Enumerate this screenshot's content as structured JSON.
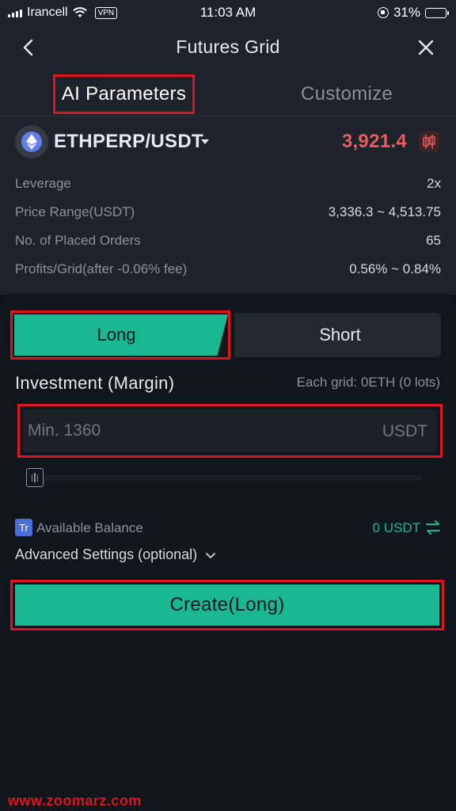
{
  "status_bar": {
    "carrier": "Irancell",
    "vpn": "VPN",
    "time": "11:03 AM",
    "battery": "31%",
    "battery_level": 0.31
  },
  "nav": {
    "title": "Futures Grid",
    "back_icon": "chevron-left-icon",
    "close_icon": "close-icon"
  },
  "tabs": [
    {
      "label": "AI Parameters",
      "active": true
    },
    {
      "label": "Customize",
      "active": false
    }
  ],
  "pair": {
    "symbol": "ETHPERP/USDT",
    "price": "3,921.4",
    "price_color": "#ea5b5e",
    "coin_icon": "ethereum-icon",
    "chart_icon": "candlestick-icon"
  },
  "params": [
    {
      "label": "Leverage",
      "value": "2x"
    },
    {
      "label": "Price Range(USDT)",
      "value": "3,336.3 ~ 4,513.75"
    },
    {
      "label": "No. of Placed Orders",
      "value": "65"
    },
    {
      "label": "Profits/Grid(after -0.06% fee)",
      "value": "0.56% ~ 0.84%"
    }
  ],
  "direction": {
    "long_label": "Long",
    "short_label": "Short",
    "selected": "Long"
  },
  "investment": {
    "label": "Investment (Margin)",
    "note": "Each grid: 0ETH (0 lots)",
    "placeholder": "Min. 1360",
    "value": "",
    "unit": "USDT",
    "slider_percent": 0
  },
  "balance": {
    "badge": "Tr",
    "label": "Available Balance",
    "value": "0 USDT",
    "swap_icon": "transfer-arrows-icon"
  },
  "advanced": {
    "label": "Advanced Settings (optional)"
  },
  "create_button": {
    "label": "Create(Long)"
  },
  "watermark": "www.zoomarz.com",
  "colors": {
    "accent_green": "#19b893",
    "highlight_red": "#e0141e",
    "background": "#11161d"
  }
}
